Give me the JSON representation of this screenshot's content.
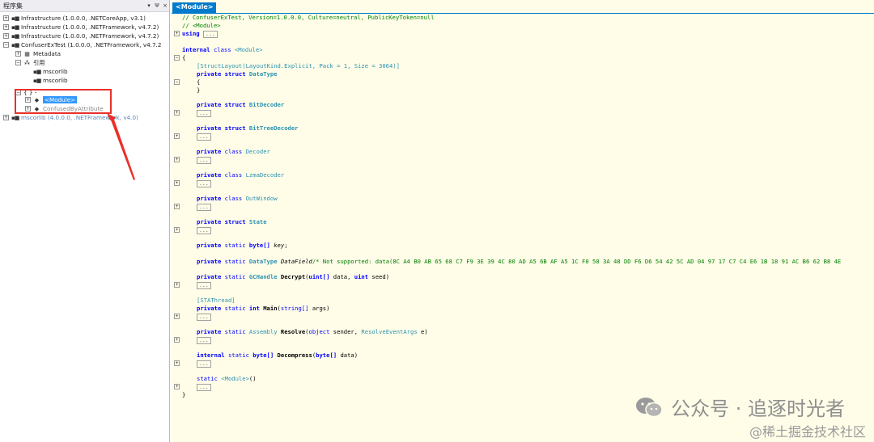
{
  "explorer": {
    "title": "程序集",
    "header_controls": [
      "▾",
      "Ψ",
      "×"
    ],
    "nodes": [
      {
        "label": "Infrastructure (1.0.0.0, .NETCoreApp, v3.1)",
        "expander": "+",
        "icon": "assembly-icon"
      },
      {
        "label": "Infrastructure (1.0.0.0, .NETFramework, v4.7.2)",
        "expander": "+",
        "icon": "assembly-icon"
      },
      {
        "label": "Infrastructure (1.0.0.0, .NETFramework, v4.7.2)",
        "expander": "+",
        "icon": "assembly-icon"
      },
      {
        "label": "ConfuserExTest (1.0.0.0, .NETFramework, v4.7.2",
        "expander": "−",
        "icon": "assembly-icon"
      },
      {
        "label": "Metadata",
        "expander": "+",
        "icon": "metadata-icon"
      },
      {
        "label": "引用",
        "expander": "−",
        "icon": "references-icon"
      },
      {
        "label": "mscorlib",
        "expander": "",
        "icon": "reference-icon"
      },
      {
        "label": "mscorlib",
        "expander": "",
        "icon": "reference-icon"
      },
      {
        "label": "{ }  -",
        "expander": "−",
        "icon": "namespace-icon"
      },
      {
        "label": "<Module>",
        "expander": "+",
        "icon": "class-icon"
      },
      {
        "label": "ConfusedByAttribute",
        "expander": "+",
        "icon": "class-icon"
      },
      {
        "label": "mscorlib (4.0.0.0, .NETFramework, v4.0)",
        "expander": "+",
        "icon": "assembly-icon"
      }
    ]
  },
  "editor": {
    "tab_label": "<Module>",
    "collapsed_marker": "...",
    "comment1": "// ConfuserExTest, Version=1.0.0.0, Culture=neutral, PublicKeyToken=null",
    "comment2": "// <Module>",
    "using_kw": "using",
    "class_decl": {
      "kw1": "internal",
      "kw2": "class",
      "name": "<Module>"
    },
    "open_brace": "{",
    "close_brace": "}",
    "attribute": "[StructLayout(LayoutKind.Explicit, Pack = 1, Size = 3064)]",
    "members": {
      "datatype": {
        "kw1": "private",
        "kw2": "struct",
        "name": "DataType"
      },
      "bitdecoder": {
        "kw1": "private",
        "kw2": "struct",
        "name": "BitDecoder"
      },
      "bittreedecoder": {
        "kw1": "private",
        "kw2": "struct",
        "name": "BitTreeDecoder"
      },
      "decoder": {
        "kw1": "private",
        "kw2": "class",
        "name": "Decoder"
      },
      "lzmadecoder": {
        "kw1": "private",
        "kw2": "class",
        "name": "LzmaDecoder"
      },
      "outwindow": {
        "kw1": "private",
        "kw2": "class",
        "name": "OutWindow"
      },
      "state": {
        "kw1": "private",
        "kw2": "struct",
        "name": "State"
      },
      "key": {
        "kw1": "private",
        "kw2": "static",
        "type": "byte[]",
        "name": "key",
        "end": ";"
      },
      "datafield": {
        "kw1": "private",
        "kw2": "static",
        "type": "DataType",
        "name": "DataField",
        "comment": "/* Not supported: data(8C A4 B0 AB 65 68 C7 F9 3E 39 4C 80 AD A5 6B AF A5 1C F0 58 3A 48 DD F6 D6 54 42 5C AD 04 97 17 C7 C4 E6 1B 18 91 AC B6 62 B8 4E"
      },
      "decrypt": {
        "kw1": "private",
        "kw2": "static",
        "type": "GCHandle",
        "name": "Decrypt",
        "p1t": "uint[]",
        "p1": " data, ",
        "p2t": "uint",
        "p2": " seed)"
      },
      "stathread": "[STAThread]",
      "main": {
        "kw1": "private",
        "kw2": "static",
        "type": "int",
        "name": "Main",
        "p1t": "string[]",
        "p1": " args)"
      },
      "resolve": {
        "kw1": "private",
        "kw2": "static",
        "type": "Assembly",
        "name": "Resolve",
        "p1t": "object",
        "p1": " sender, ",
        "p2t": "ResolveEventArgs",
        "p2": " e)"
      },
      "decompress": {
        "kw1": "internal",
        "kw2": "static",
        "type": "byte[]",
        "name": "Decompress",
        "p1t": "byte[]",
        "p1": " data)"
      },
      "cctor": {
        "kw1": "static",
        "name": "<Module>",
        "end": "()"
      }
    }
  },
  "watermark": {
    "primary": "公众号 · 追逐时光者",
    "secondary": "@稀土掘金技术社区"
  },
  "colors": {
    "accent": "#007acc",
    "selection": "#3399ff",
    "highlight_box": "#e8312a",
    "editor_bg": "#fffde8",
    "keyword": "#0000ff",
    "comment": "#008000",
    "type": "#2b91af"
  }
}
